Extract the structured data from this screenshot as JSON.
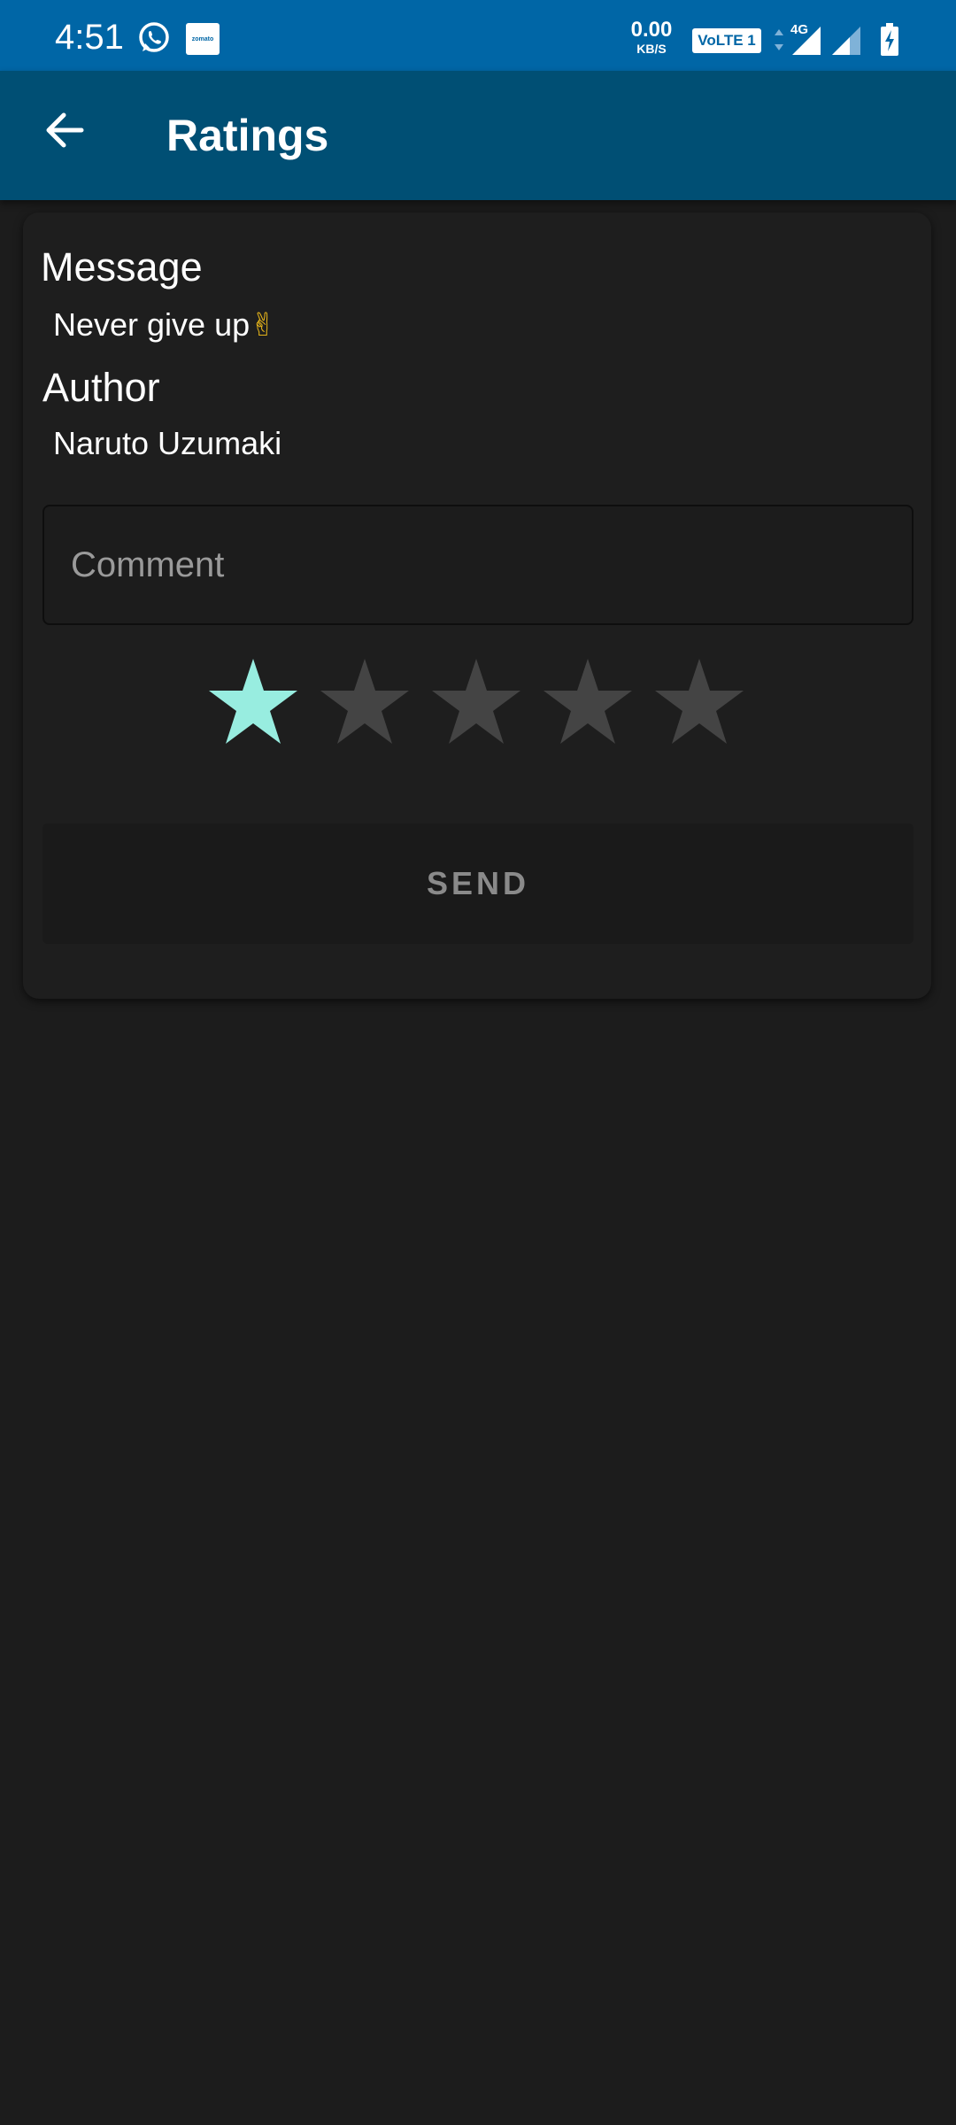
{
  "status_bar": {
    "time": "4:51",
    "net_speed_value": "0.00",
    "net_speed_unit": "KB/S",
    "volte": "VoLTE 1",
    "network": "4G",
    "zomato_label": "zomato",
    "color": "#0066a6"
  },
  "app_bar": {
    "title": "Ratings",
    "color": "#004f74"
  },
  "card": {
    "message_label": "Message",
    "message_text": "Never give up",
    "message_emoji": "✌",
    "author_label": "Author",
    "author_text": "Naruto Uzumaki",
    "comment_placeholder": "Comment",
    "comment_value": "",
    "rating": {
      "value": 1,
      "max": 5,
      "active_color": "#98ede0",
      "inactive_color": "#444444"
    },
    "send_label": "SEND"
  }
}
